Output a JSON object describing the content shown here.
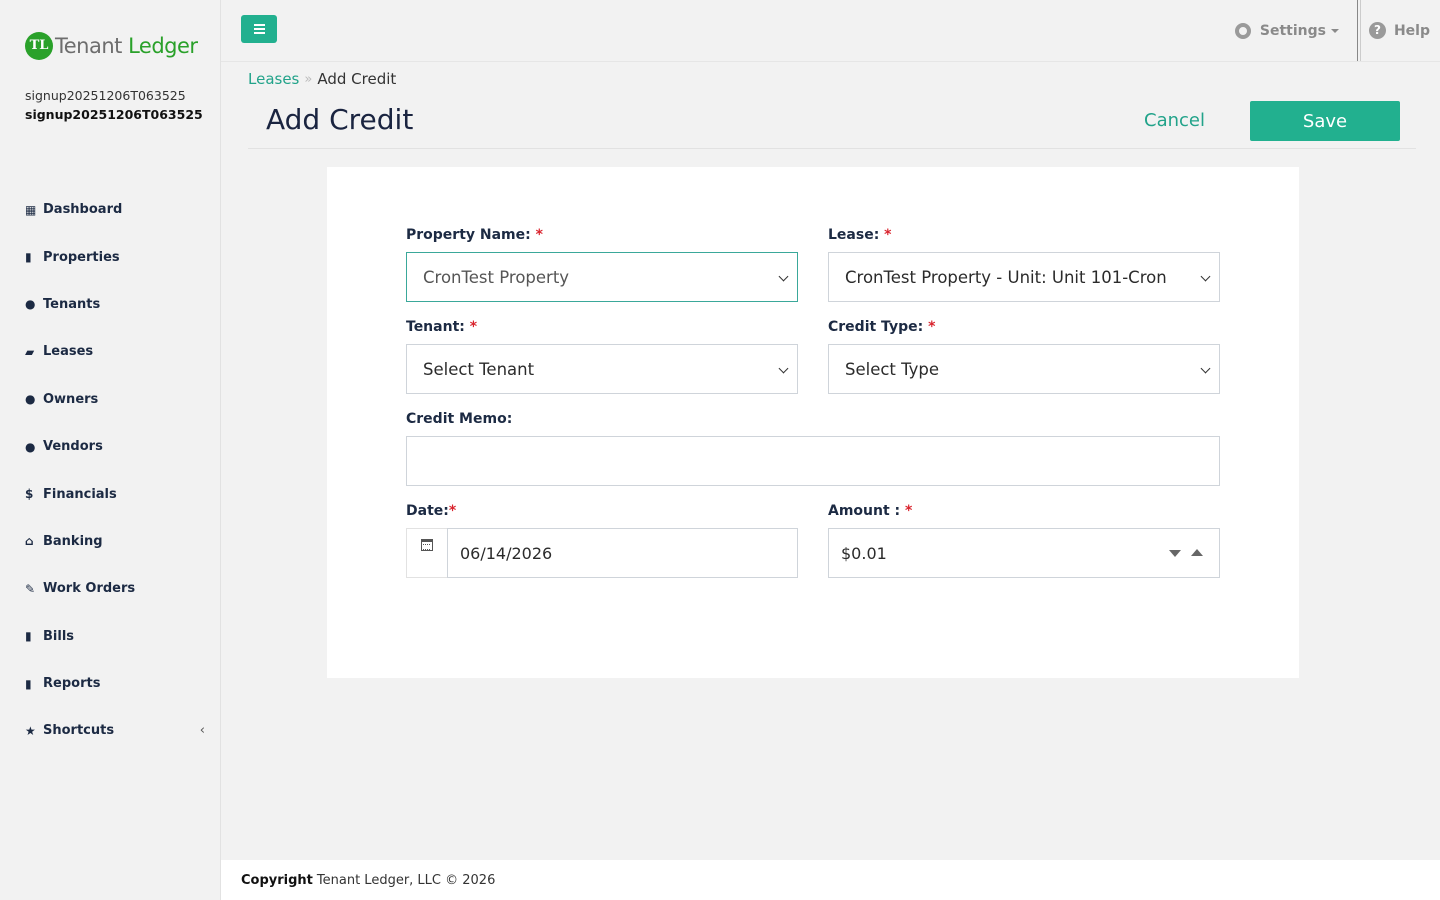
{
  "app": {
    "logo_text_1": "Tenant",
    "logo_text_2": "Ledger",
    "logo_mark": "TL"
  },
  "user": {
    "line1": "signup20251206T063525",
    "line2": "signup20251206T063525"
  },
  "sidebar": {
    "items": [
      {
        "label": "Dashboard",
        "icon": "dashboard-icon",
        "glyph": "▦"
      },
      {
        "label": "Properties",
        "icon": "building-icon",
        "glyph": "▮"
      },
      {
        "label": "Tenants",
        "icon": "user-icon",
        "glyph": "●"
      },
      {
        "label": "Leases",
        "icon": "folder-open-icon",
        "glyph": "▰"
      },
      {
        "label": "Owners",
        "icon": "users-icon",
        "glyph": "●"
      },
      {
        "label": "Vendors",
        "icon": "users-icon",
        "glyph": "●"
      },
      {
        "label": "Financials",
        "icon": "dollar-icon",
        "glyph": "$"
      },
      {
        "label": "Banking",
        "icon": "bank-icon",
        "glyph": "⌂"
      },
      {
        "label": "Work Orders",
        "icon": "edit-icon",
        "glyph": "✎"
      },
      {
        "label": "Bills",
        "icon": "file-icon",
        "glyph": "▮"
      },
      {
        "label": "Reports",
        "icon": "file-icon",
        "glyph": "▮"
      },
      {
        "label": "Shortcuts",
        "icon": "star-icon",
        "glyph": "★",
        "chevron": "‹"
      }
    ]
  },
  "topbar": {
    "settings_label": "Settings",
    "help_label": "Help",
    "help_glyph": "?"
  },
  "breadcrumb": {
    "parent": "Leases",
    "separator": "»",
    "current": "Add Credit"
  },
  "page": {
    "title": "Add Credit",
    "cancel_label": "Cancel",
    "save_label": "Save"
  },
  "form": {
    "property_label": "Property Name:",
    "property_value": "CronTest Property",
    "lease_label": "Lease:",
    "lease_value": "CronTest Property - Unit: Unit 101-Cron",
    "tenant_label": "Tenant:",
    "tenant_value": "Select Tenant",
    "credit_type_label": "Credit Type:",
    "credit_type_value": "Select Type",
    "memo_label": "Credit Memo:",
    "memo_value": "",
    "date_label": "Date:",
    "date_value": "06/14/2026",
    "amount_label": "Amount :",
    "amount_value": "$0.01",
    "required_mark": "*"
  },
  "footer": {
    "copyright_bold": "Copyright",
    "copyright_text": "Tenant Ledger, LLC © 2026"
  },
  "colors": {
    "accent": "#22b08f",
    "link": "#22a38a",
    "brand_green": "#2aa12a",
    "required": "#d9232d"
  }
}
